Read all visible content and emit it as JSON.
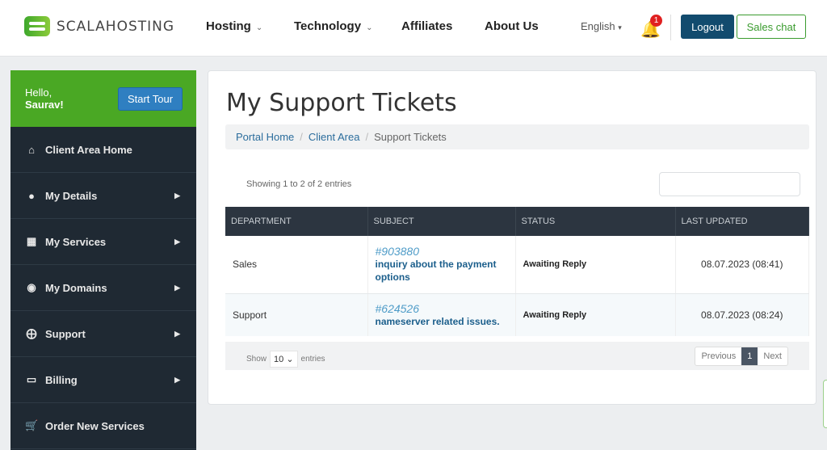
{
  "header": {
    "brand": "SCALAHOSTING",
    "nav": [
      {
        "label": "Hosting",
        "dropdown": true
      },
      {
        "label": "Technology",
        "dropdown": true
      },
      {
        "label": "Affiliates"
      },
      {
        "label": "About Us"
      }
    ],
    "language": "English",
    "notification_count": "1",
    "logout": "Logout",
    "sales_chat": "Sales chat"
  },
  "sidebar": {
    "greeting": "Hello,",
    "user": "Saurav!",
    "start_tour": "Start Tour",
    "items": [
      {
        "label": "Client Area Home",
        "icon": "home-icon"
      },
      {
        "label": "My Details",
        "icon": "user-icon"
      },
      {
        "label": "My Services",
        "icon": "grid-icon"
      },
      {
        "label": "My Domains",
        "icon": "globe-icon"
      },
      {
        "label": "Support",
        "icon": "lifebuoy-icon"
      },
      {
        "label": "Billing",
        "icon": "money-icon"
      },
      {
        "label": "Order New Services",
        "icon": "cart-icon"
      }
    ]
  },
  "main": {
    "title": "My Support Tickets",
    "breadcrumb": [
      "Portal Home",
      "Client Area",
      "Support Tickets"
    ],
    "showing": "Showing 1 to 2 of 2 entries",
    "search_value": "",
    "columns": [
      "DEPARTMENT",
      "SUBJECT",
      "STATUS",
      "LAST UPDATED"
    ],
    "rows": [
      {
        "department": "Sales",
        "id": "#903880",
        "subject": "inquiry about the payment options",
        "status": "Awaiting Reply",
        "updated": "08.07.2023 (08:41)"
      },
      {
        "department": "Support",
        "id": "#624526",
        "subject": "nameserver related issues.",
        "status": "Awaiting Reply",
        "updated": "08.07.2023 (08:24)"
      }
    ],
    "show_label": "Show",
    "page_size": "10",
    "entries_label": "entries",
    "pagination": {
      "previous": "Previous",
      "current": "1",
      "next": "Next"
    }
  },
  "colors": {
    "brand_green": "#4aa824",
    "navy": "#124b6e",
    "sidebar": "#1f2933",
    "table_header": "#2c3540"
  }
}
